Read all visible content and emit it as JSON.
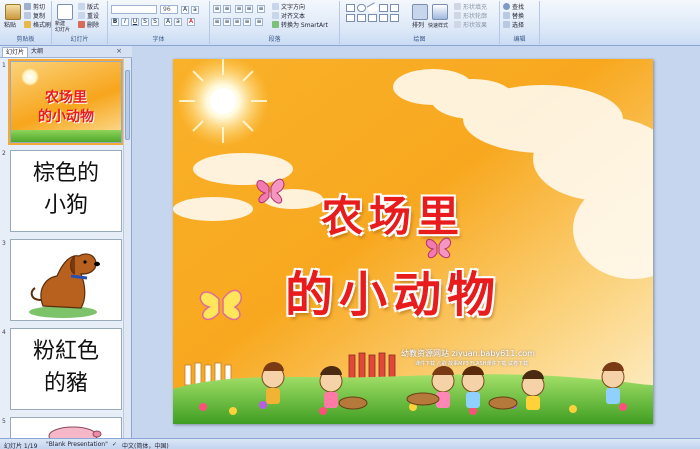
{
  "ribbon": {
    "clipboard": {
      "paste": "粘贴",
      "cut": "剪切",
      "copy": "复制",
      "format_painter": "格式刷",
      "label": "剪贴板"
    },
    "slides": {
      "new_slide": "新建\n幻灯片",
      "layout": "版式",
      "reset": "重设",
      "delete": "删除",
      "label": "幻灯片"
    },
    "font": {
      "font_size": "96",
      "label": "字体"
    },
    "paragraph": {
      "text_direction": "文字方向",
      "align_text": "对齐文本",
      "smartart": "转换为 SmartArt",
      "label": "段落"
    },
    "drawing": {
      "arrange": "排列",
      "quick_styles": "快速样式",
      "shape_fill": "形状填充",
      "shape_outline": "形状轮廓",
      "shape_effects": "形状效果",
      "label": "绘图"
    },
    "editing": {
      "find": "查找",
      "replace": "替换",
      "select": "选择",
      "label": "编辑"
    }
  },
  "panel": {
    "tabs": [
      "幻灯片",
      "大纲"
    ],
    "slides": [
      {
        "number": "1",
        "title_line1": "农场里",
        "title_line2": "的小动物"
      },
      {
        "number": "2",
        "text_line1": "棕色的",
        "text_line2": "小狗"
      },
      {
        "number": "3"
      },
      {
        "number": "4",
        "text_line1": "粉紅色",
        "text_line2": "的豬"
      },
      {
        "number": "5"
      }
    ]
  },
  "slide": {
    "title_line1": "农场里",
    "title_line2": "的小动物",
    "watermark_site": "幼教资源网站  ziyuan.baby611.com",
    "watermark_sub": "课件下载  儿歌  故事MP3  FLASH课件下载  试卷下载"
  },
  "status": {
    "slide_counter": "幻灯片 1/19",
    "theme": "\"Blank Presentation\"",
    "language": "中文(简体，中国)"
  },
  "colors": {
    "title_red": "#e81c1c",
    "sky_orange": "#f7a51c",
    "ribbon_blue": "#dbe7f7"
  }
}
